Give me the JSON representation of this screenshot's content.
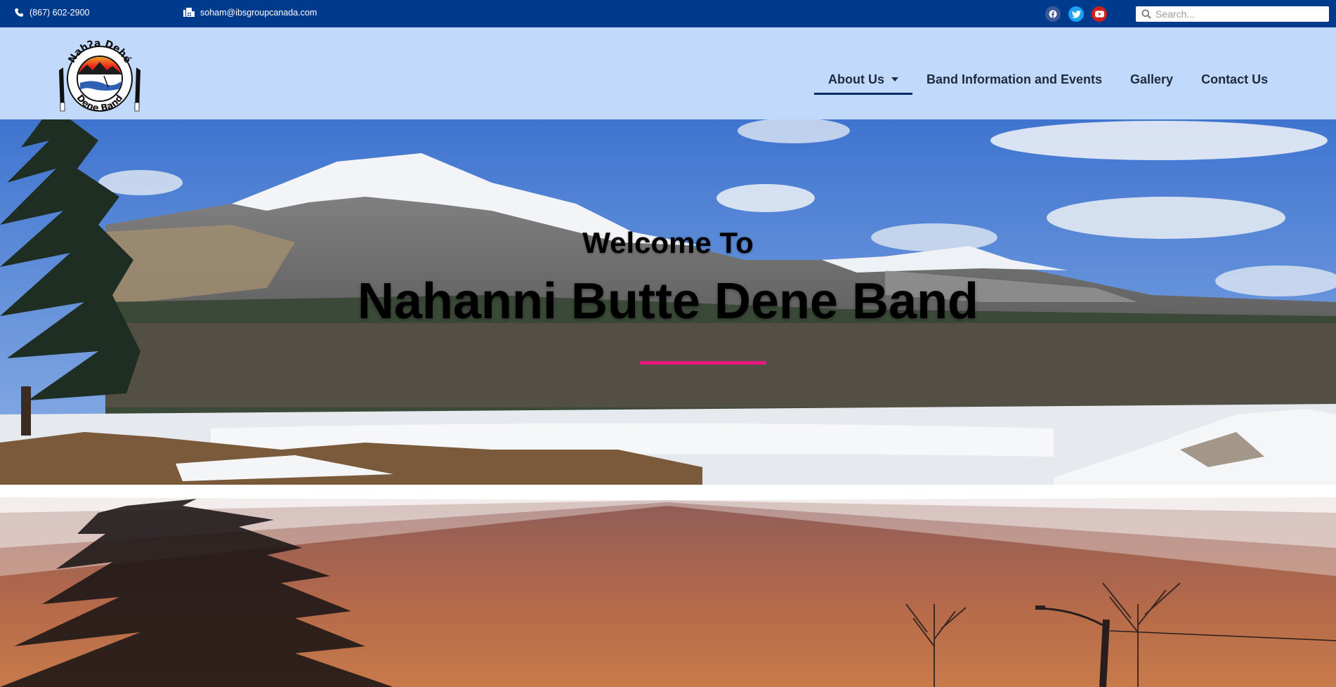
{
  "topbar": {
    "phone": "(867) 602-2900",
    "email": "soham@ibsgroupcanada.com",
    "social": [
      "facebook-icon",
      "twitter-icon",
      "youtube-icon"
    ],
    "search_placeholder": "Search..."
  },
  "header": {
    "logo_alt": "Nahʔa Dehé Dene Band",
    "logo_text_top": "Nahʔa Dehé",
    "logo_text_bottom": "Dene Band",
    "nav": [
      {
        "label": "About Us",
        "has_dropdown": true,
        "active": true
      },
      {
        "label": "Band Information and Events",
        "has_dropdown": false,
        "active": false
      },
      {
        "label": "Gallery",
        "has_dropdown": false,
        "active": false
      },
      {
        "label": "Contact Us",
        "has_dropdown": false,
        "active": false
      }
    ]
  },
  "hero": {
    "welcome": "Welcome To",
    "title": "Nahanni Butte Dene Band",
    "accent_color": "#e8177f"
  },
  "colors": {
    "topbar": "#003a8c",
    "header": "#c1dafc"
  }
}
